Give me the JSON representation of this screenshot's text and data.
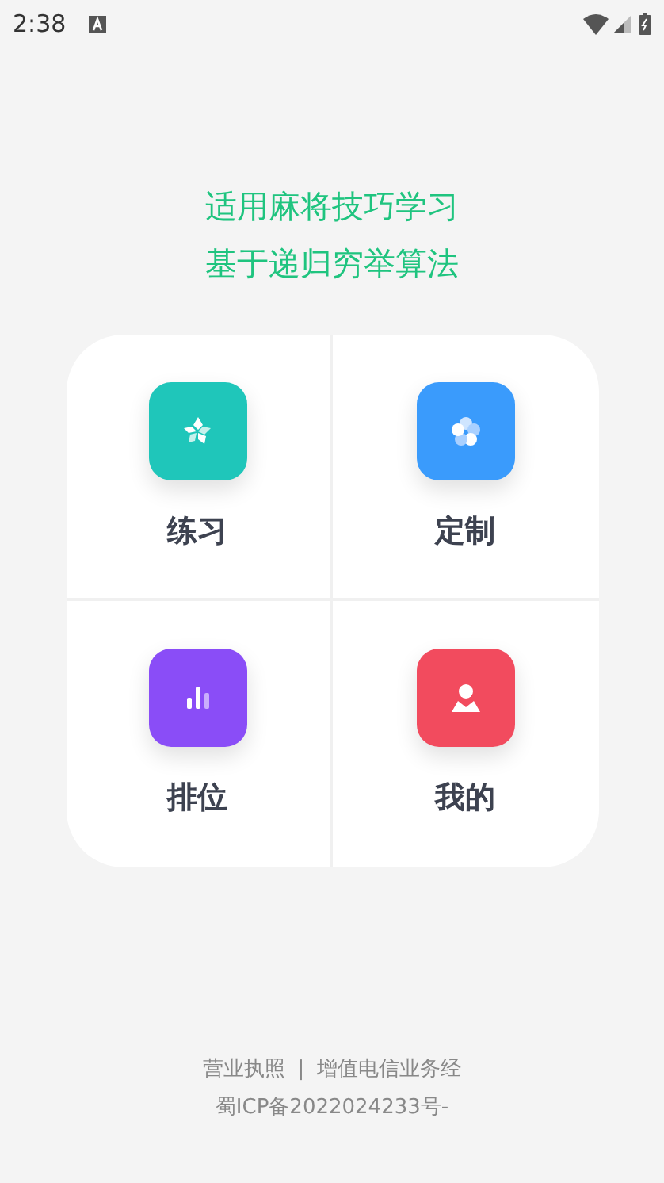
{
  "status_bar": {
    "time": "2:38"
  },
  "headline": [
    "适用麻将技巧学习",
    "基于递归穷举算法"
  ],
  "menu": [
    {
      "label": "练习",
      "kind": "practice",
      "color": "#1fc6ba"
    },
    {
      "label": "定制",
      "kind": "custom",
      "color": "#3a9bfc"
    },
    {
      "label": "排位",
      "kind": "ranking",
      "color": "#8a4df7"
    },
    {
      "label": "我的",
      "kind": "profile",
      "color": "#f24b5e"
    }
  ],
  "footer": {
    "links": [
      "营业执照",
      "增值电信业务经"
    ],
    "separator": "|",
    "icp": "蜀ICP备2022024233号-"
  }
}
